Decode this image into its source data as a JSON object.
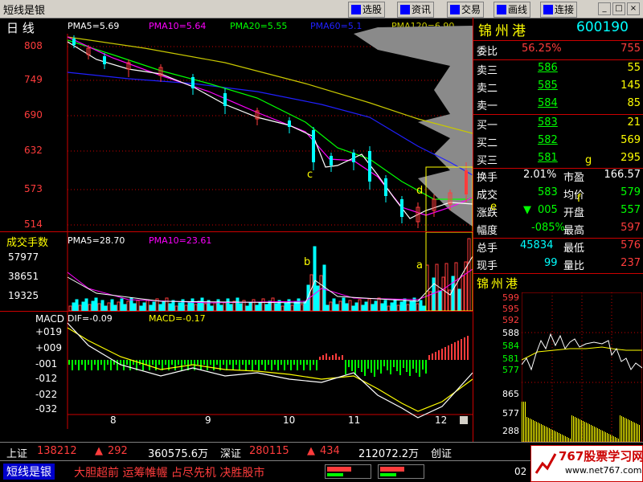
{
  "app_title": "短线是银",
  "toolbar": {
    "buttons": [
      "选股",
      "资讯",
      "交易",
      "画线",
      "连接"
    ],
    "window_controls": [
      "_",
      "□",
      "×"
    ]
  },
  "main_chart": {
    "period_label": "日  线",
    "ma_labels": [
      {
        "text": "PMA5=5.69",
        "color": "#ffffff"
      },
      {
        "text": "PMA10=5.64",
        "color": "#ff00ff"
      },
      {
        "text": "PMA20=5.55",
        "color": "#00ff00"
      },
      {
        "text": "PMA60=5.1",
        "color": "#2020ff"
      },
      {
        "text": "PMA120=6.90",
        "color": "#c8c800"
      }
    ],
    "y_ticks": [
      "808",
      "749",
      "690",
      "632",
      "573",
      "514"
    ],
    "annotations": [
      "c",
      "d",
      "e",
      "f",
      "g"
    ]
  },
  "volume_chart": {
    "title": "成交手数",
    "ma_labels": [
      {
        "text": "PMA5=28.70",
        "color": "#ffffff"
      },
      {
        "text": "PMA10=23.61",
        "color": "#ff00ff"
      }
    ],
    "y_ticks": [
      "57977",
      "38651",
      "19325"
    ],
    "annotations": [
      "b",
      "a"
    ]
  },
  "macd_chart": {
    "title": "MACD",
    "dif_label": "DIF=-0.09",
    "macd_label": "MACD=-0.17",
    "y_ticks": [
      "+019",
      "+009",
      "-001",
      "-012",
      "-022",
      "-032"
    ],
    "x_ticks": [
      "8",
      "9",
      "10",
      "11",
      "12"
    ]
  },
  "quote_panel": {
    "stock_name": "锦州港",
    "stock_code": "600190",
    "weibi": {
      "label": "委比",
      "value": "56.25%",
      "value2": "755"
    },
    "sells": [
      {
        "label": "卖三",
        "price": "586",
        "vol": "55"
      },
      {
        "label": "卖二",
        "price": "585",
        "vol": "145"
      },
      {
        "label": "卖一",
        "price": "584",
        "vol": "85"
      }
    ],
    "buys": [
      {
        "label": "买一",
        "price": "583",
        "vol": "21"
      },
      {
        "label": "买二",
        "price": "582",
        "vol": "569"
      },
      {
        "label": "买三",
        "price": "581",
        "vol": "295"
      }
    ],
    "stats": [
      {
        "l1": "换手",
        "v1": "2.01%",
        "l2": "市盈",
        "v2": "166.57"
      },
      {
        "l1": "成交",
        "v1": "583",
        "l2": "均价",
        "v2": "579"
      },
      {
        "l1": "涨跌",
        "v1": "005",
        "l2": "开盘",
        "v2": "557"
      },
      {
        "l1": "幅度",
        "v1": "-085%",
        "l2": "最高",
        "v2": "597"
      },
      {
        "l1": "总手",
        "v1": "45834",
        "l2": "最低",
        "v2": "576"
      },
      {
        "l1": "现手",
        "v1": "99",
        "l2": "量比",
        "v2": "237"
      }
    ],
    "intraday_title": "锦州港",
    "intraday_price_ticks": [
      "599",
      "595",
      "592",
      "588",
      "584",
      "581",
      "577"
    ],
    "intraday_vol_ticks": [
      "865",
      "577",
      "288"
    ]
  },
  "status_bar": {
    "sh_label": "上证",
    "sh_index": "138212",
    "sh_change": "292",
    "sh_amount": "360575.6万",
    "sz_label": "深证",
    "sz_index": "280115",
    "sz_change": "434",
    "sz_amount": "212072.2万",
    "cy_label": "创证"
  },
  "footer": {
    "brand": "短线是银",
    "slogan": "大胆超前 运筹帷幄 占尽先机 决胜股市",
    "watermark": "767股票学习网",
    "watermark_url": "www.net767.com",
    "time_prefix": "02"
  },
  "colors": {
    "up": "#ff3c3c",
    "down": "#00ffff",
    "panel_border": "#c00000",
    "label_yellow": "#ffff00",
    "cyan": "#00ffff"
  }
}
